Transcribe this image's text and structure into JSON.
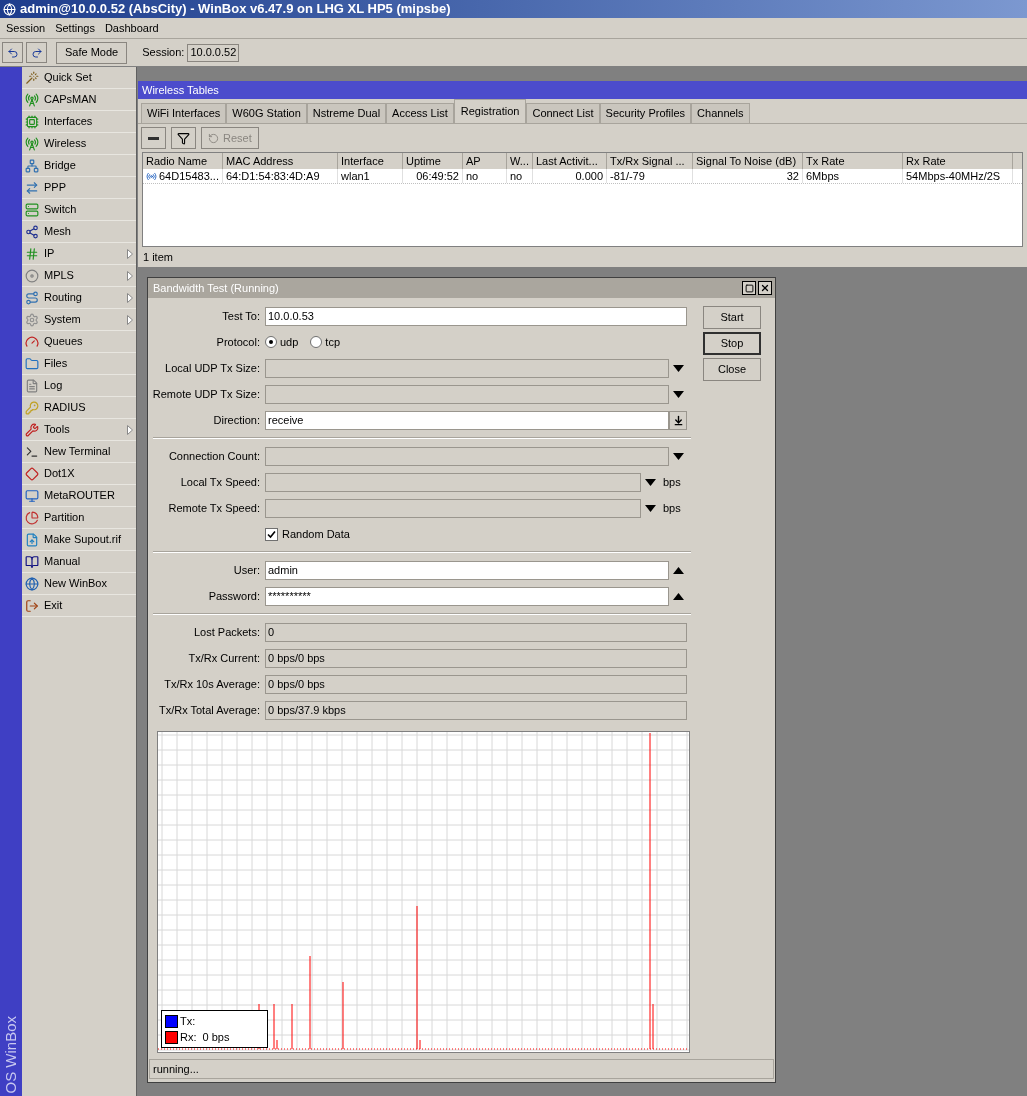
{
  "window": {
    "title": "admin@10.0.0.52 (AbsCity) - WinBox v6.47.9 on LHG XL HP5 (mipsbe)"
  },
  "menu": [
    "Session",
    "Settings",
    "Dashboard"
  ],
  "toolbar": {
    "safe_mode": "Safe Mode",
    "session_label": "Session:",
    "session_value": "10.0.0.52"
  },
  "side_strip": "OS WinBox",
  "sidebar": {
    "items": [
      {
        "label": "Quick Set",
        "submenu": false
      },
      {
        "label": "CAPsMAN",
        "submenu": false
      },
      {
        "label": "Interfaces",
        "submenu": false
      },
      {
        "label": "Wireless",
        "submenu": false
      },
      {
        "label": "Bridge",
        "submenu": false
      },
      {
        "label": "PPP",
        "submenu": false
      },
      {
        "label": "Switch",
        "submenu": false
      },
      {
        "label": "Mesh",
        "submenu": false
      },
      {
        "label": "IP",
        "submenu": true
      },
      {
        "label": "MPLS",
        "submenu": true
      },
      {
        "label": "Routing",
        "submenu": true
      },
      {
        "label": "System",
        "submenu": true
      },
      {
        "label": "Queues",
        "submenu": false
      },
      {
        "label": "Files",
        "submenu": false
      },
      {
        "label": "Log",
        "submenu": false
      },
      {
        "label": "RADIUS",
        "submenu": false
      },
      {
        "label": "Tools",
        "submenu": true
      },
      {
        "label": "New Terminal",
        "submenu": false
      },
      {
        "label": "Dot1X",
        "submenu": false
      },
      {
        "label": "MetaROUTER",
        "submenu": false
      },
      {
        "label": "Partition",
        "submenu": false
      },
      {
        "label": "Make Supout.rif",
        "submenu": false
      },
      {
        "label": "Manual",
        "submenu": false
      },
      {
        "label": "New WinBox",
        "submenu": false
      },
      {
        "label": "Exit",
        "submenu": false
      }
    ]
  },
  "wireless_tables": {
    "title": "Wireless Tables",
    "tabs": [
      {
        "label": "WiFi Interfaces",
        "selected": false
      },
      {
        "label": "W60G Station",
        "selected": false
      },
      {
        "label": "Nstreme Dual",
        "selected": false
      },
      {
        "label": "Access List",
        "selected": false
      },
      {
        "label": "Registration",
        "selected": true
      },
      {
        "label": "Connect List",
        "selected": false
      },
      {
        "label": "Security Profiles",
        "selected": false
      },
      {
        "label": "Channels",
        "selected": false
      }
    ],
    "reset": {
      "label": "Reset",
      "disabled": true
    },
    "table": {
      "columns": [
        "Radio Name",
        "MAC Address",
        "Interface",
        "Uptime",
        "AP",
        "W...",
        "Last Activit...",
        "Tx/Rx Signal ...",
        "Signal To Noise (dB)",
        "Tx Rate",
        "Rx Rate"
      ],
      "rows": [
        [
          "64D15483...",
          "64:D1:54:83:4D:A9",
          "wlan1",
          "06:49:52",
          "no",
          "no",
          "0.000",
          "-81/-79",
          "32",
          "6Mbps",
          "54Mbps-40MHz/2S"
        ]
      ]
    },
    "status": "1 item"
  },
  "bandwidth_test": {
    "title": "Bandwidth Test (Running)",
    "buttons": [
      "Start",
      "Stop",
      "Close"
    ],
    "fields": [
      {
        "kind": "input",
        "label": "Test To:",
        "value": "10.0.0.53",
        "disabled": false
      },
      {
        "kind": "radio",
        "label": "Protocol:",
        "options": [
          {
            "label": "udp",
            "selected": true
          },
          {
            "label": "tcp",
            "selected": false
          }
        ]
      },
      {
        "kind": "dropdown",
        "label": "Local UDP Tx Size:",
        "disabled": true,
        "expanded": false
      },
      {
        "kind": "dropdown",
        "label": "Remote UDP Tx Size:",
        "disabled": true,
        "expanded": false
      },
      {
        "kind": "select",
        "label": "Direction:",
        "value": "receive",
        "disabled": false
      },
      {
        "kind": "separator"
      },
      {
        "kind": "dropdown",
        "label": "Connection Count:",
        "disabled": true,
        "expanded": false
      },
      {
        "kind": "dropdown",
        "label": "Local Tx Speed:",
        "disabled": true,
        "expanded": false,
        "unit": "bps"
      },
      {
        "kind": "dropdown",
        "label": "Remote Tx Speed:",
        "disabled": true,
        "expanded": false,
        "unit": "bps"
      },
      {
        "kind": "checkbox",
        "label": "Random Data",
        "checked": true
      },
      {
        "kind": "separator"
      },
      {
        "kind": "dropdown",
        "label": "User:",
        "value": "admin",
        "disabled": false,
        "expanded": true
      },
      {
        "kind": "dropdown",
        "label": "Password:",
        "value": "**********",
        "disabled": false,
        "expanded": true
      },
      {
        "kind": "separator"
      },
      {
        "kind": "readonly",
        "label": "Lost Packets:",
        "value": "0"
      },
      {
        "kind": "readonly",
        "label": "Tx/Rx Current:",
        "value": "0 bps/0 bps"
      },
      {
        "kind": "readonly",
        "label": "Tx/Rx 10s Average:",
        "value": "0 bps/0 bps"
      },
      {
        "kind": "readonly",
        "label": "Tx/Rx Total Average:",
        "value": "0 bps/37.9 kbps"
      }
    ],
    "legend": [
      {
        "label": "Tx:",
        "color": "#0000ff"
      },
      {
        "label": "Rx:",
        "value": "0 bps",
        "color": "#ff0000"
      }
    ],
    "status": "running..."
  }
}
